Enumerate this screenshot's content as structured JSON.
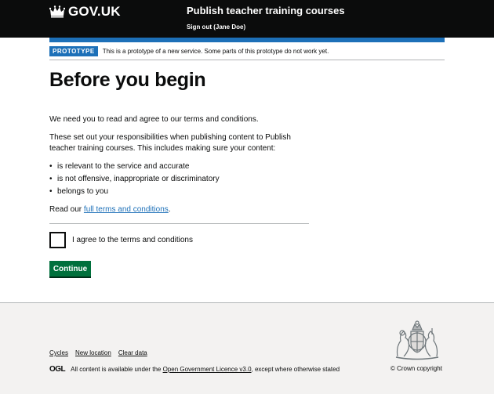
{
  "header": {
    "logo_icon": "crown-icon",
    "logo_text": "GOV.UK",
    "service_name": "Publish teacher training courses",
    "signout": "Sign out (Jane Doe)"
  },
  "phase_banner": {
    "tag": "PROTOTYPE",
    "text": "This is a prototype of a new service. Some parts of this prototype do not work yet."
  },
  "main": {
    "title": "Before you begin",
    "intro": "We need you to read and agree to our terms and conditions.",
    "responsibilities": "These set out your responsibilities when publishing content to Publish teacher training courses. This includes making sure your content:",
    "bullets": [
      "is relevant to the service and accurate",
      "is not offensive, inappropriate or discriminatory",
      "belongs to you"
    ],
    "read_prefix": "Read our ",
    "read_link": "full terms and conditions",
    "read_suffix": ".",
    "checkbox_label": "I agree to the terms and conditions",
    "checkbox_checked": false,
    "continue_label": "Continue"
  },
  "footer": {
    "links": [
      "Cycles",
      "New location",
      "Clear data"
    ],
    "ogl_logo": "OGL",
    "licence_prefix": "All content is available under the ",
    "licence_link": "Open Government Licence v3.0",
    "licence_suffix": ", except where otherwise stated",
    "crest_icon": "royal-coat-of-arms-icon",
    "copyright": "© Crown copyright"
  },
  "colors": {
    "header_bg": "#0b0c0c",
    "brand_blue": "#1d70b8",
    "button_green": "#00703c",
    "footer_bg": "#f3f2f1"
  }
}
